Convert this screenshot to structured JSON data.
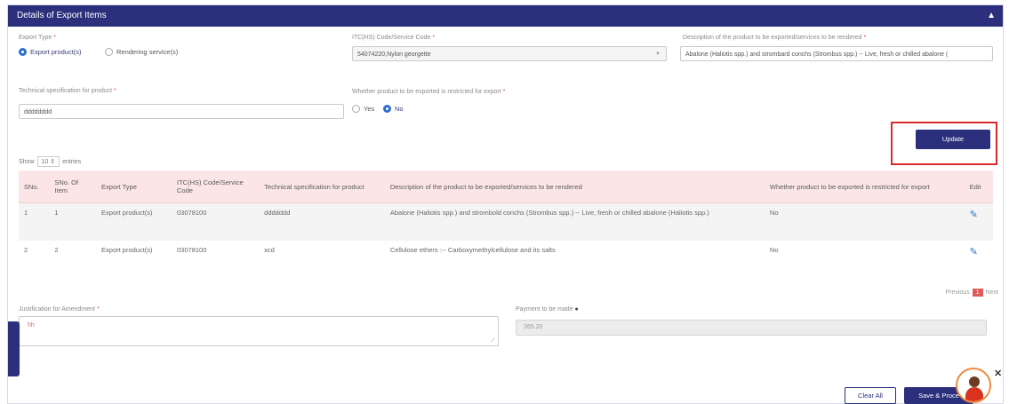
{
  "header": {
    "title": "Details of Export Items",
    "collapse_icon": "▲"
  },
  "form": {
    "export_type": {
      "label": "Export Type",
      "opt1": "Export product(s)",
      "opt2": "Rendering service(s)",
      "selected": "opt1"
    },
    "itc_code": {
      "label": "ITC(HS) Code/Service Code",
      "value": "54074220,Nylon georgette"
    },
    "description": {
      "label": "Description of the product to be exported/services to be rendered",
      "value": "Abalone (Haliotis spp.) and strombard conchs (Strombus spp.) -- Live, fresh or chilled abalone ("
    },
    "tech_spec": {
      "label": "Technical specification for product",
      "value": "dddddddd"
    },
    "restricted": {
      "label": "Whether product to be exported is restricted for export",
      "yes": "Yes",
      "no": "No",
      "selected": "no"
    }
  },
  "update_label": "Update",
  "show": {
    "prefix": "Show",
    "value": "10",
    "suffix": "entries"
  },
  "table": {
    "headers": [
      "SNo.",
      "SNo. Of Item",
      "Export Type",
      "ITC(HS) Code/Service Code",
      "Technical specification for product",
      "Description of the product to be exported/services to be rendered",
      "Whether product to be exported is restricted for export",
      "Edit"
    ],
    "rows": [
      [
        "1",
        "1",
        "Export product(s)",
        "03078100",
        "ddddddd",
        "Abalone (Haliotis spp.) and strombold conchs (Strombus spp.) -- Live, fresh or chilled abalone (Haliotis spp.)",
        "No"
      ],
      [
        "2",
        "2",
        "Export product(s)",
        "03078100",
        "xcd",
        "Cellulose ethers :-- Carboxymethylcellulose and its salts",
        "No"
      ]
    ]
  },
  "pager": {
    "prev": "Previous",
    "current": "1",
    "next": "Next"
  },
  "justification": {
    "label": "Justification for Amendment",
    "value": "hh"
  },
  "payment": {
    "label": "Payment to be made",
    "value": "265.20"
  },
  "buttons": {
    "clear": "Clear All",
    "save": "Save & Proce"
  },
  "colors": {
    "header": "#2b2f7c",
    "highlight": "#d62b2b",
    "table_head": "#fbe5e6"
  }
}
